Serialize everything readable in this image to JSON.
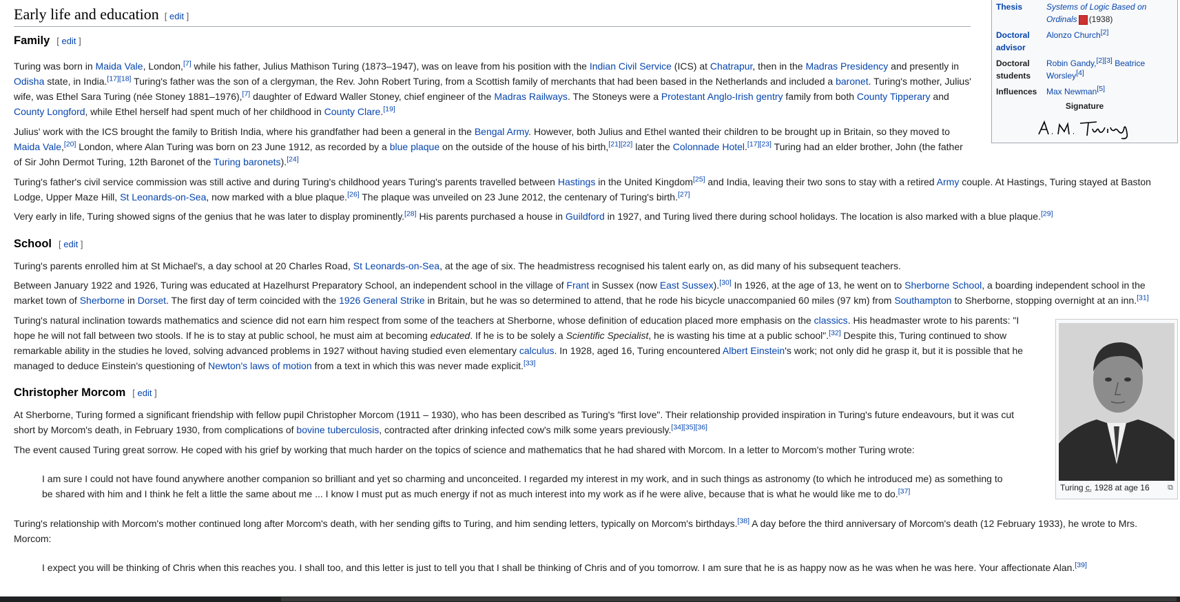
{
  "section": {
    "title": "Early life and education",
    "edit": "edit"
  },
  "family": {
    "title": "Family",
    "p1": [
      {
        "t": "Turing was born in "
      },
      {
        "l": "Maida Vale"
      },
      {
        "t": ", London,"
      },
      {
        "s": "[7]"
      },
      {
        "t": " while his father, Julius Mathison Turing (1873–1947), was on leave from his position with the "
      },
      {
        "l": "Indian Civil Service"
      },
      {
        "t": " (ICS) at "
      },
      {
        "l": "Chatrapur"
      },
      {
        "t": ", then in the "
      },
      {
        "l": "Madras Presidency"
      },
      {
        "t": " and presently in "
      },
      {
        "l": "Odisha"
      },
      {
        "t": " state, in India."
      },
      {
        "s": "[17][18]"
      },
      {
        "t": " Turing's father was the son of a clergyman, the Rev. John Robert Turing, from a Scottish family of merchants that had been based in the Netherlands and included a "
      },
      {
        "l": "baronet"
      },
      {
        "t": ". Turing's mother, Julius' wife, was Ethel Sara Turing (née Stoney 1881–1976),"
      },
      {
        "s": "[7]"
      },
      {
        "t": " daughter of Edward Waller Stoney, chief engineer of the "
      },
      {
        "l": "Madras Railways"
      },
      {
        "t": ". The Stoneys were a "
      },
      {
        "l": "Protestant Anglo-Irish gentry"
      },
      {
        "t": " family from both "
      },
      {
        "l": "County Tipperary"
      },
      {
        "t": " and "
      },
      {
        "l": "County Longford"
      },
      {
        "t": ", while Ethel herself had spent much of her childhood in "
      },
      {
        "l": "County Clare"
      },
      {
        "t": "."
      },
      {
        "s": "[19]"
      }
    ],
    "p2": [
      {
        "t": "Julius' work with the ICS brought the family to British India, where his grandfather had been a general in the "
      },
      {
        "l": "Bengal Army"
      },
      {
        "t": ". However, both Julius and Ethel wanted their children to be brought up in Britain, so they moved to "
      },
      {
        "l": "Maida Vale"
      },
      {
        "t": ","
      },
      {
        "s": "[20]"
      },
      {
        "t": " London, where Alan Turing was born on 23 June 1912, as recorded by a "
      },
      {
        "l": "blue plaque"
      },
      {
        "t": " on the outside of the house of his birth,"
      },
      {
        "s": "[21][22]"
      },
      {
        "t": " later the "
      },
      {
        "l": "Colonnade Hotel"
      },
      {
        "t": "."
      },
      {
        "s": "[17][23]"
      },
      {
        "t": " Turing had an elder brother, John (the father of Sir John Dermot Turing, 12th Baronet of the "
      },
      {
        "l": "Turing baronets"
      },
      {
        "t": ")."
      },
      {
        "s": "[24]"
      }
    ],
    "p3": [
      {
        "t": "Turing's father's civil service commission was still active and during Turing's childhood years Turing's parents travelled between "
      },
      {
        "l": "Hastings"
      },
      {
        "t": " in the United Kingdom"
      },
      {
        "s": "[25]"
      },
      {
        "t": " and India, leaving their two sons to stay with a retired "
      },
      {
        "l": "Army"
      },
      {
        "t": " couple. At Hastings, Turing stayed at Baston Lodge, Upper Maze Hill, "
      },
      {
        "l": "St Leonards-on-Sea"
      },
      {
        "t": ", now marked with a blue plaque."
      },
      {
        "s": "[26]"
      },
      {
        "t": " The plaque was unveiled on 23 June 2012, the centenary of Turing's birth."
      },
      {
        "s": "[27]"
      }
    ],
    "p4": [
      {
        "t": "Very early in life, Turing showed signs of the genius that he was later to display prominently."
      },
      {
        "s": "[28]"
      },
      {
        "t": " His parents purchased a house in "
      },
      {
        "l": "Guildford"
      },
      {
        "t": " in 1927, and Turing lived there during school holidays. The location is also marked with a blue plaque."
      },
      {
        "s": "[29]"
      }
    ]
  },
  "school": {
    "title": "School",
    "p1": [
      {
        "t": "Turing's parents enrolled him at St Michael's, a day school at 20 Charles Road, "
      },
      {
        "l": "St Leonards-on-Sea"
      },
      {
        "t": ", at the age of six. The headmistress recognised his talent early on, as did many of his subsequent teachers."
      }
    ],
    "p2": [
      {
        "t": "Between January 1922 and 1926, Turing was educated at Hazelhurst Preparatory School, an independent school in the village of "
      },
      {
        "l": "Frant"
      },
      {
        "t": " in Sussex (now "
      },
      {
        "l": "East Sussex"
      },
      {
        "t": ")."
      },
      {
        "s": "[30]"
      },
      {
        "t": " In 1926, at the age of 13, he went on to "
      },
      {
        "l": "Sherborne School"
      },
      {
        "t": ", a boarding independent school in the market town of "
      },
      {
        "l": "Sherborne"
      },
      {
        "t": " in "
      },
      {
        "l": "Dorset"
      },
      {
        "t": ". The first day of term coincided with the "
      },
      {
        "l": "1926 General Strike"
      },
      {
        "t": " in Britain, but he was so determined to attend, that he rode his bicycle unaccompanied 60 miles (97 km) from "
      },
      {
        "l": "Southampton"
      },
      {
        "t": " to Sherborne, stopping overnight at an inn."
      },
      {
        "s": "[31]"
      }
    ],
    "p3": [
      {
        "t": "Turing's natural inclination towards mathematics and science did not earn him respect from some of the teachers at Sherborne, whose definition of education placed more emphasis on the "
      },
      {
        "l": "classics"
      },
      {
        "t": ". His headmaster wrote to his parents: \"I hope he will not fall between two stools. If he is to stay at public school, he must aim at becoming "
      },
      {
        "i": "educated"
      },
      {
        "t": ". If he is to be solely a "
      },
      {
        "i": "Scientific Specialist"
      },
      {
        "t": ", he is wasting his time at a public school\"."
      },
      {
        "s": "[32]"
      },
      {
        "t": " Despite this, Turing continued to show remarkable ability in the studies he loved, solving advanced problems in 1927 without having studied even elementary "
      },
      {
        "l": "calculus"
      },
      {
        "t": ". In 1928, aged 16, Turing encountered "
      },
      {
        "l": "Albert Einstein"
      },
      {
        "t": "'s work; not only did he grasp it, but it is possible that he managed to deduce Einstein's questioning of "
      },
      {
        "l": "Newton's laws of motion"
      },
      {
        "t": " from a text in which this was never made explicit."
      },
      {
        "s": "[33]"
      }
    ]
  },
  "morcom": {
    "title": "Christopher Morcom",
    "p1": [
      {
        "t": "At Sherborne, Turing formed a significant friendship with fellow pupil Christopher Morcom (1911 – 1930), who has been described as Turing's \"first love\". Their relationship provided inspiration in Turing's future endeavours, but it was cut short by Morcom's death, in February 1930, from complications of "
      },
      {
        "l": "bovine tuberculosis"
      },
      {
        "t": ", contracted after drinking infected cow's milk some years previously."
      },
      {
        "s": "[34][35][36]"
      }
    ],
    "p2": [
      {
        "t": "The event caused Turing great sorrow. He coped with his grief by working that much harder on the topics of science and mathematics that he had shared with Morcom. In a letter to Morcom's mother Turing wrote:"
      }
    ],
    "q1": [
      {
        "t": "I am sure I could not have found anywhere another companion so brilliant and yet so charming and unconceited. I regarded my interest in my work, and in such things as astronomy (to which he introduced me) as something to be shared with him and I think he felt a little the same about me ... I know I must put as much energy if not as much interest into my work as if he were alive, because that is what he would like me to do."
      },
      {
        "s": "[37]"
      }
    ],
    "p3": [
      {
        "t": "Turing's relationship with Morcom's mother continued long after Morcom's death, with her sending gifts to Turing, and him sending letters, typically on Morcom's birthdays."
      },
      {
        "s": "[38]"
      },
      {
        "t": " A day before the third anniversary of Morcom's death (12 February 1933), he wrote to Mrs. Morcom:"
      }
    ],
    "q2": [
      {
        "t": "I expect you will be thinking of Chris when this reaches you. I shall too, and this letter is just to tell you that I shall be thinking of Chris and of you tomorrow. I am sure that he is as happy now as he was when he was here. Your affectionate Alan."
      },
      {
        "s": "[39]"
      }
    ]
  },
  "infobox": {
    "thesis_label": "Thesis",
    "thesis_link": "Systems of Logic Based on Ordinals",
    "thesis_year": "(1938)",
    "advisor_label": "Doctoral advisor",
    "advisor": "Alonzo Church",
    "advisor_ref": "[2]",
    "students_label": "Doctoral students",
    "student1": "Robin Gandy,",
    "student1_ref": "[2][3]",
    "student2": "Beatrice Worsley",
    "student2_ref": "[4]",
    "influences_label": "Influences",
    "influence": "Max Newman",
    "influence_ref": "[5]",
    "signature_label": "Signature"
  },
  "figure": {
    "caption": "Turing c. 1928 at age 16",
    "caption_c": "c.",
    "caption_pre": "Turing ",
    "caption_post": " 1928 at age 16"
  }
}
